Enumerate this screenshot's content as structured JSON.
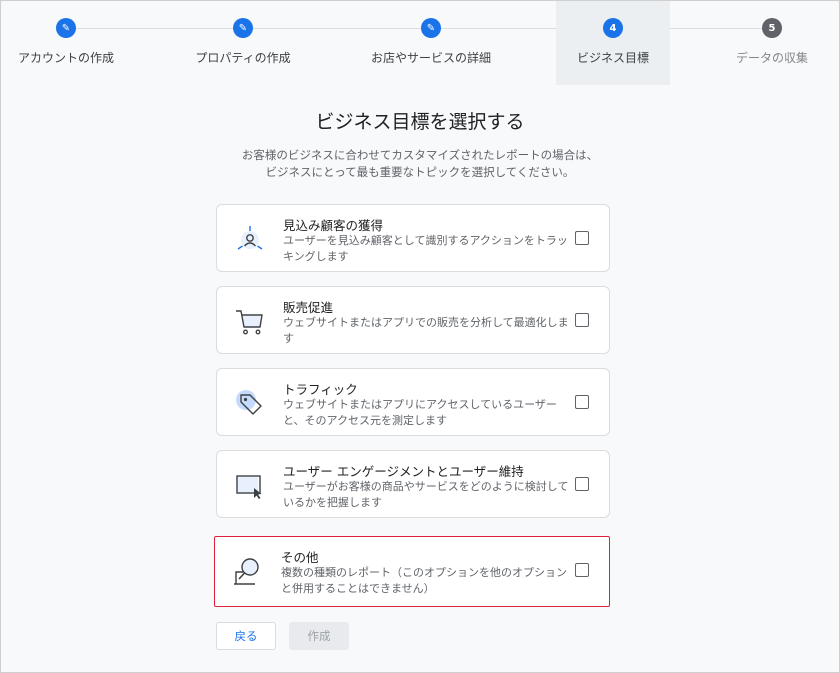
{
  "stepper": {
    "steps": [
      {
        "label": "アカウントの作成",
        "state": "done",
        "marker": "✎"
      },
      {
        "label": "プロパティの作成",
        "state": "done",
        "marker": "✎"
      },
      {
        "label": "お店やサービスの詳細",
        "state": "done",
        "marker": "✎"
      },
      {
        "label": "ビジネス目標",
        "state": "current",
        "marker": "4"
      },
      {
        "label": "データの収集",
        "state": "pending",
        "marker": "5"
      }
    ]
  },
  "main": {
    "title": "ビジネス目標を選択する",
    "description_line1": "お客様のビジネスに合わせてカスタマイズされたレポートの場合は、",
    "description_line2": "ビジネスにとって最も重要なトピックを選択してください。"
  },
  "goals": [
    {
      "title": "見込み顧客の獲得",
      "desc": "ユーザーを見込み顧客として識別するアクションをトラッキングします",
      "icon": "lead-generation-icon",
      "checked": false
    },
    {
      "title": "販売促進",
      "desc": "ウェブサイトまたはアプリでの販売を分析して最適化します",
      "icon": "shopping-cart-icon",
      "checked": false
    },
    {
      "title": "トラフィック",
      "desc": "ウェブサイトまたはアプリにアクセスしているユーザーと、そのアクセス元を測定します",
      "icon": "tag-icon",
      "checked": false
    },
    {
      "title": "ユーザー エンゲージメントとユーザー維持",
      "desc": "ユーザーがお客様の商品やサービスをどのように検討しているかを把握します",
      "icon": "screen-cursor-icon",
      "checked": false
    },
    {
      "title": "その他",
      "desc": "複数の種類のレポート（このオプションを他のオプションと併用することはできません）",
      "icon": "magnifier-icon",
      "checked": false
    }
  ],
  "buttons": {
    "back": "戻る",
    "create": "作成"
  },
  "colors": {
    "accent": "#1a73e8",
    "highlight_outline": "#e0203a"
  }
}
